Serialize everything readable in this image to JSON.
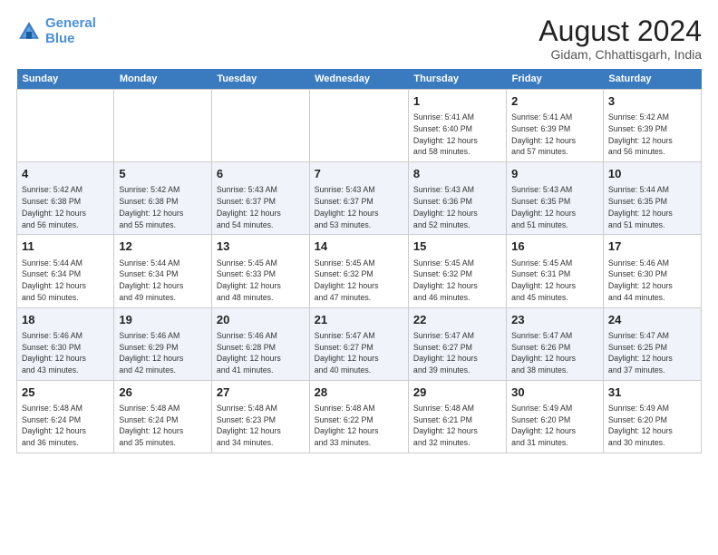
{
  "logo": {
    "line1": "General",
    "line2": "Blue"
  },
  "title": "August 2024",
  "subtitle": "Gidam, Chhattisgarh, India",
  "weekdays": [
    "Sunday",
    "Monday",
    "Tuesday",
    "Wednesday",
    "Thursday",
    "Friday",
    "Saturday"
  ],
  "weeks": [
    [
      {
        "day": "",
        "info": ""
      },
      {
        "day": "",
        "info": ""
      },
      {
        "day": "",
        "info": ""
      },
      {
        "day": "",
        "info": ""
      },
      {
        "day": "1",
        "info": "Sunrise: 5:41 AM\nSunset: 6:40 PM\nDaylight: 12 hours\nand 58 minutes."
      },
      {
        "day": "2",
        "info": "Sunrise: 5:41 AM\nSunset: 6:39 PM\nDaylight: 12 hours\nand 57 minutes."
      },
      {
        "day": "3",
        "info": "Sunrise: 5:42 AM\nSunset: 6:39 PM\nDaylight: 12 hours\nand 56 minutes."
      }
    ],
    [
      {
        "day": "4",
        "info": "Sunrise: 5:42 AM\nSunset: 6:38 PM\nDaylight: 12 hours\nand 56 minutes."
      },
      {
        "day": "5",
        "info": "Sunrise: 5:42 AM\nSunset: 6:38 PM\nDaylight: 12 hours\nand 55 minutes."
      },
      {
        "day": "6",
        "info": "Sunrise: 5:43 AM\nSunset: 6:37 PM\nDaylight: 12 hours\nand 54 minutes."
      },
      {
        "day": "7",
        "info": "Sunrise: 5:43 AM\nSunset: 6:37 PM\nDaylight: 12 hours\nand 53 minutes."
      },
      {
        "day": "8",
        "info": "Sunrise: 5:43 AM\nSunset: 6:36 PM\nDaylight: 12 hours\nand 52 minutes."
      },
      {
        "day": "9",
        "info": "Sunrise: 5:43 AM\nSunset: 6:35 PM\nDaylight: 12 hours\nand 51 minutes."
      },
      {
        "day": "10",
        "info": "Sunrise: 5:44 AM\nSunset: 6:35 PM\nDaylight: 12 hours\nand 51 minutes."
      }
    ],
    [
      {
        "day": "11",
        "info": "Sunrise: 5:44 AM\nSunset: 6:34 PM\nDaylight: 12 hours\nand 50 minutes."
      },
      {
        "day": "12",
        "info": "Sunrise: 5:44 AM\nSunset: 6:34 PM\nDaylight: 12 hours\nand 49 minutes."
      },
      {
        "day": "13",
        "info": "Sunrise: 5:45 AM\nSunset: 6:33 PM\nDaylight: 12 hours\nand 48 minutes."
      },
      {
        "day": "14",
        "info": "Sunrise: 5:45 AM\nSunset: 6:32 PM\nDaylight: 12 hours\nand 47 minutes."
      },
      {
        "day": "15",
        "info": "Sunrise: 5:45 AM\nSunset: 6:32 PM\nDaylight: 12 hours\nand 46 minutes."
      },
      {
        "day": "16",
        "info": "Sunrise: 5:45 AM\nSunset: 6:31 PM\nDaylight: 12 hours\nand 45 minutes."
      },
      {
        "day": "17",
        "info": "Sunrise: 5:46 AM\nSunset: 6:30 PM\nDaylight: 12 hours\nand 44 minutes."
      }
    ],
    [
      {
        "day": "18",
        "info": "Sunrise: 5:46 AM\nSunset: 6:30 PM\nDaylight: 12 hours\nand 43 minutes."
      },
      {
        "day": "19",
        "info": "Sunrise: 5:46 AM\nSunset: 6:29 PM\nDaylight: 12 hours\nand 42 minutes."
      },
      {
        "day": "20",
        "info": "Sunrise: 5:46 AM\nSunset: 6:28 PM\nDaylight: 12 hours\nand 41 minutes."
      },
      {
        "day": "21",
        "info": "Sunrise: 5:47 AM\nSunset: 6:27 PM\nDaylight: 12 hours\nand 40 minutes."
      },
      {
        "day": "22",
        "info": "Sunrise: 5:47 AM\nSunset: 6:27 PM\nDaylight: 12 hours\nand 39 minutes."
      },
      {
        "day": "23",
        "info": "Sunrise: 5:47 AM\nSunset: 6:26 PM\nDaylight: 12 hours\nand 38 minutes."
      },
      {
        "day": "24",
        "info": "Sunrise: 5:47 AM\nSunset: 6:25 PM\nDaylight: 12 hours\nand 37 minutes."
      }
    ],
    [
      {
        "day": "25",
        "info": "Sunrise: 5:48 AM\nSunset: 6:24 PM\nDaylight: 12 hours\nand 36 minutes."
      },
      {
        "day": "26",
        "info": "Sunrise: 5:48 AM\nSunset: 6:24 PM\nDaylight: 12 hours\nand 35 minutes."
      },
      {
        "day": "27",
        "info": "Sunrise: 5:48 AM\nSunset: 6:23 PM\nDaylight: 12 hours\nand 34 minutes."
      },
      {
        "day": "28",
        "info": "Sunrise: 5:48 AM\nSunset: 6:22 PM\nDaylight: 12 hours\nand 33 minutes."
      },
      {
        "day": "29",
        "info": "Sunrise: 5:48 AM\nSunset: 6:21 PM\nDaylight: 12 hours\nand 32 minutes."
      },
      {
        "day": "30",
        "info": "Sunrise: 5:49 AM\nSunset: 6:20 PM\nDaylight: 12 hours\nand 31 minutes."
      },
      {
        "day": "31",
        "info": "Sunrise: 5:49 AM\nSunset: 6:20 PM\nDaylight: 12 hours\nand 30 minutes."
      }
    ]
  ]
}
